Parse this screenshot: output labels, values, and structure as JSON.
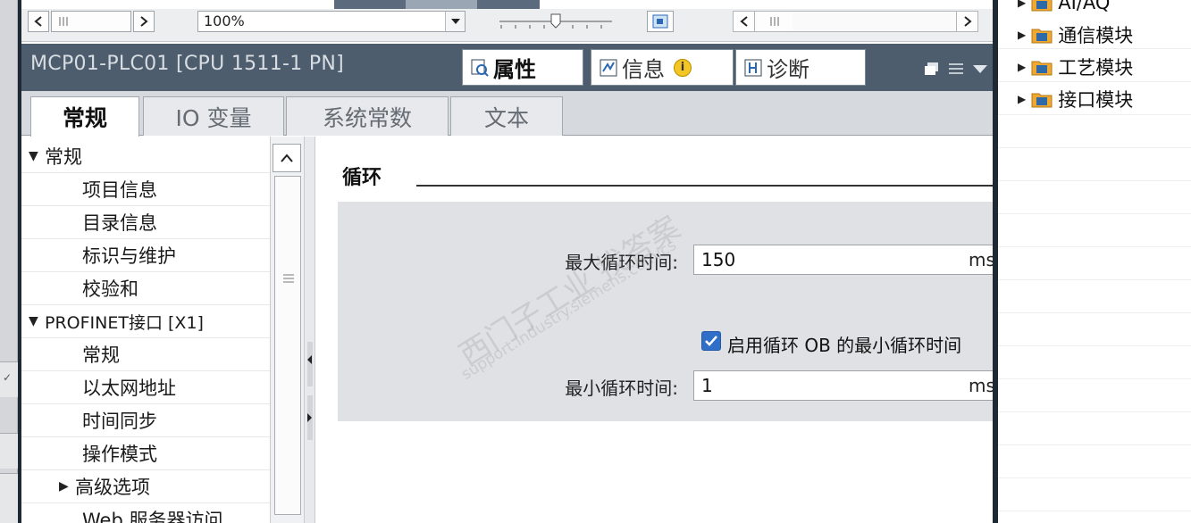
{
  "toolbar": {
    "zoom_value": "100%"
  },
  "panel": {
    "title": "MCP01-PLC01 [CPU 1511-1 PN]",
    "tabs": [
      {
        "label": "属性",
        "active": true,
        "icon": "properties-icon"
      },
      {
        "label": "信息",
        "active": false,
        "icon": "info-icon"
      },
      {
        "label": "诊断",
        "active": false,
        "icon": "diagnostics-icon"
      }
    ]
  },
  "subtabs": [
    {
      "label": "常规",
      "active": true
    },
    {
      "label": "IO 变量",
      "active": false
    },
    {
      "label": "系统常数",
      "active": false
    },
    {
      "label": "文本",
      "active": false
    }
  ],
  "tree": [
    {
      "label": "常规",
      "level": 0,
      "expander": "▼"
    },
    {
      "label": "项目信息",
      "level": 1,
      "expander": ""
    },
    {
      "label": "目录信息",
      "level": 1,
      "expander": ""
    },
    {
      "label": "标识与维护",
      "level": 1,
      "expander": ""
    },
    {
      "label": "校验和",
      "level": 1,
      "expander": ""
    },
    {
      "label": "PROFINET接口 [X1]",
      "level": 0,
      "expander": "▼"
    },
    {
      "label": "常规",
      "level": 1,
      "expander": ""
    },
    {
      "label": "以太网地址",
      "level": 1,
      "expander": ""
    },
    {
      "label": "时间同步",
      "level": 1,
      "expander": ""
    },
    {
      "label": "操作模式",
      "level": 1,
      "expander": ""
    },
    {
      "label": "高级选项",
      "level": 1,
      "expander": "▶"
    },
    {
      "label": "Web 服务器访问",
      "level": 1,
      "expander": ""
    }
  ],
  "content": {
    "section_title": "循环",
    "max_cycle_label": "最大循环时间:",
    "max_cycle_value": "150",
    "max_cycle_unit": "ms",
    "enable_min_cycle_label": "启用循环 OB 的最小循环时间",
    "enable_min_cycle_checked": true,
    "min_cycle_label": "最小循环时间:",
    "min_cycle_value": "1",
    "min_cycle_unit": "ms"
  },
  "catalog": {
    "items": [
      {
        "label": "AI/AQ"
      },
      {
        "label": "通信模块"
      },
      {
        "label": "工艺模块"
      },
      {
        "label": "接口模块"
      }
    ]
  },
  "watermark": {
    "line1": "西门子工业 找答案",
    "line2": "support.industry.siemens.com/cs"
  },
  "colors": {
    "frame": "#1f2933",
    "titlebar": "#4e5d6d",
    "checkbox": "#2f6fc7",
    "folder": "#f0a830"
  }
}
